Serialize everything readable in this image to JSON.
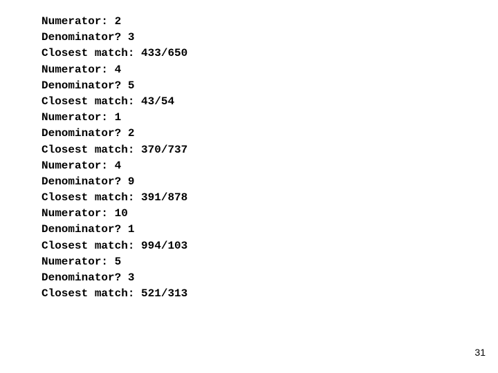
{
  "entries": [
    {
      "numerator": "2",
      "denominator": "3",
      "match": "433/650"
    },
    {
      "numerator": "4",
      "denominator": "5",
      "match": "43/54"
    },
    {
      "numerator": "1",
      "denominator": "2",
      "match": "370/737"
    },
    {
      "numerator": "4",
      "denominator": "9",
      "match": "391/878"
    },
    {
      "numerator": "10",
      "denominator": "1",
      "match": "994/103"
    },
    {
      "numerator": "5",
      "denominator": "3",
      "match": "521/313"
    }
  ],
  "labels": {
    "numerator_prefix": "Numerator: ",
    "denominator_prefix": "Denominator? ",
    "match_prefix": "Closest match: "
  },
  "page_number": "31"
}
